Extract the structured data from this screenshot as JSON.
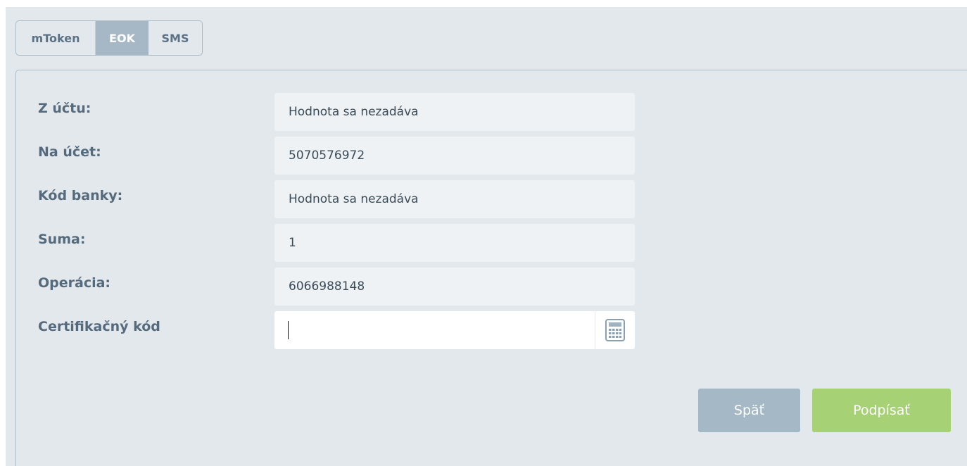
{
  "tabs": [
    {
      "label": "mToken",
      "active": false
    },
    {
      "label": "EOK",
      "active": true
    },
    {
      "label": "SMS",
      "active": false
    }
  ],
  "form": {
    "from_account": {
      "label": "Z účtu:",
      "value": "Hodnota sa nezadáva"
    },
    "to_account": {
      "label": "Na účet:",
      "value": "5070576972"
    },
    "bank_code": {
      "label": "Kód banky:",
      "value": "Hodnota sa nezadáva"
    },
    "amount": {
      "label": "Suma:",
      "value": "1"
    },
    "operation": {
      "label": "Operácia:",
      "value": "6066988148"
    },
    "cert_code": {
      "label": "Certifikačný kód",
      "value": "",
      "icon": "calculator-icon"
    }
  },
  "buttons": {
    "back_label": "Späť",
    "sign_label": "Podpísať"
  },
  "colors": {
    "background": "#e2e8ec",
    "tab_active": "#a6b8c6",
    "back_button": "#a5b8c6",
    "sign_button": "#a6d175",
    "label_text": "#556b7d"
  }
}
